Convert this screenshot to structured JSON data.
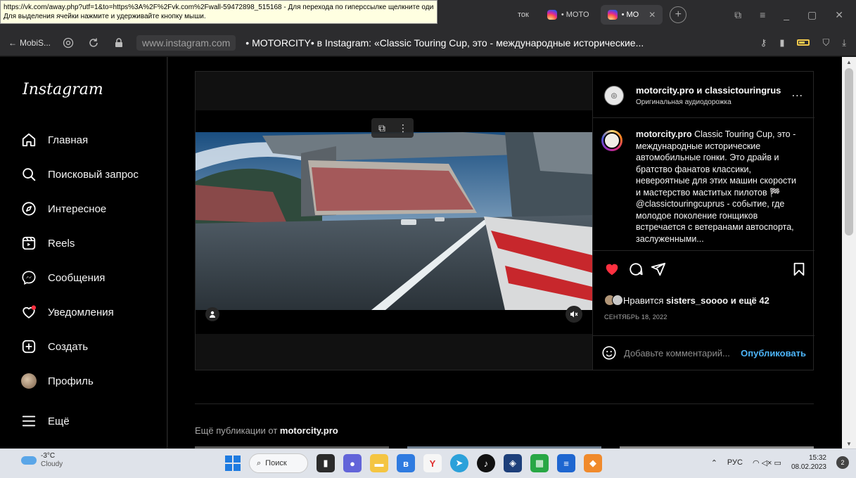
{
  "tooltip": {
    "line1": "https://vk.com/away.php?utf=1&to=https%3A%2F%2Fvk.com%2Fwall-59472898_515168 - Для перехода по гиперссылке щелкните один раз.",
    "line2": "Для выделения ячейки нажмите и удерживайте кнопку мыши."
  },
  "tabs": [
    {
      "label": "ток"
    },
    {
      "label": "• MOTO"
    },
    {
      "label": "• MO"
    }
  ],
  "addressbar": {
    "back_label": "MobiS...",
    "url": "www.instagram.com",
    "page_title": "• MOTORCITY• в Instagram: «Classic Touring Cup, это - международные исторические..."
  },
  "sidebar": {
    "logo": "Instagram",
    "items": [
      {
        "label": "Главная",
        "icon": "home-icon"
      },
      {
        "label": "Поисковый запрос",
        "icon": "search-icon"
      },
      {
        "label": "Интересное",
        "icon": "compass-icon"
      },
      {
        "label": "Reels",
        "icon": "reels-icon"
      },
      {
        "label": "Сообщения",
        "icon": "messenger-icon"
      },
      {
        "label": "Уведомления",
        "icon": "heart-icon"
      },
      {
        "label": "Создать",
        "icon": "plus-square-icon"
      },
      {
        "label": "Профиль",
        "icon": "avatar"
      },
      {
        "label": "Ещё",
        "icon": "menu-icon"
      }
    ]
  },
  "post": {
    "header": {
      "authors": "motorcity.pro и classictouringrus",
      "audio": "Оригинальная аудиодорожка",
      "more": "..."
    },
    "caption": {
      "username": "motorcity.pro",
      "text": " Classic Touring Cup, это - международные исторические автомобильные гонки. Это драйв и братство фанатов классики, невероятные для этих машин скорости и мастерство маститых пилотов 🏁 @classictouringcuprus - событие, где молодое поколение гонщиков встречается с ветеранами автоспорта, заслуженными..."
    },
    "likes": {
      "prefix": "Нравится ",
      "user": "sisters_soooo",
      "suffix": " и ещё 42"
    },
    "date": "СЕНТЯБРЬ 18, 2022",
    "comment": {
      "placeholder": "Добавьте комментарий...",
      "publish": "Опубликовать"
    },
    "liked": true,
    "accent_color": "#ff3040"
  },
  "more_publications": {
    "prefix": "Ещё публикации от ",
    "user": "motorcity.pro"
  },
  "taskbar": {
    "weather_temp": "-3°C",
    "weather_desc": "Cloudy",
    "search_label": "Поиск",
    "lang": "РУС",
    "time": "15:32",
    "date": "08.02.2023"
  }
}
